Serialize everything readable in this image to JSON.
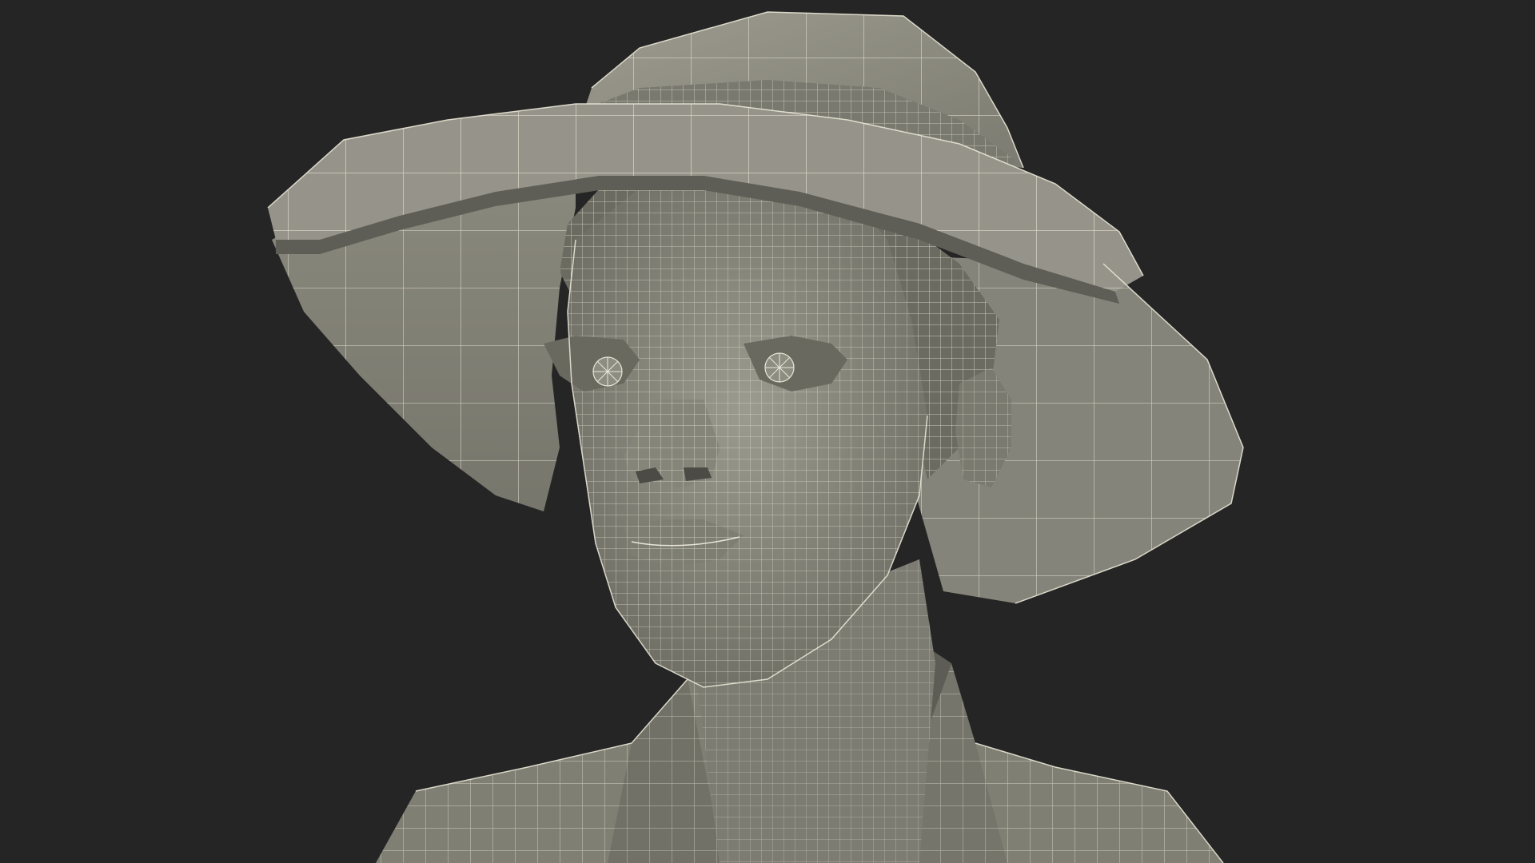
{
  "scene": {
    "background_color": "#252525",
    "mesh_fill": "#8a897e",
    "mesh_fill_dark": "#6f6e65",
    "mesh_fill_light": "#a6a498",
    "wire_color": "#e9e6d6",
    "subject": "wireframe-bust-with-sun-hat"
  }
}
